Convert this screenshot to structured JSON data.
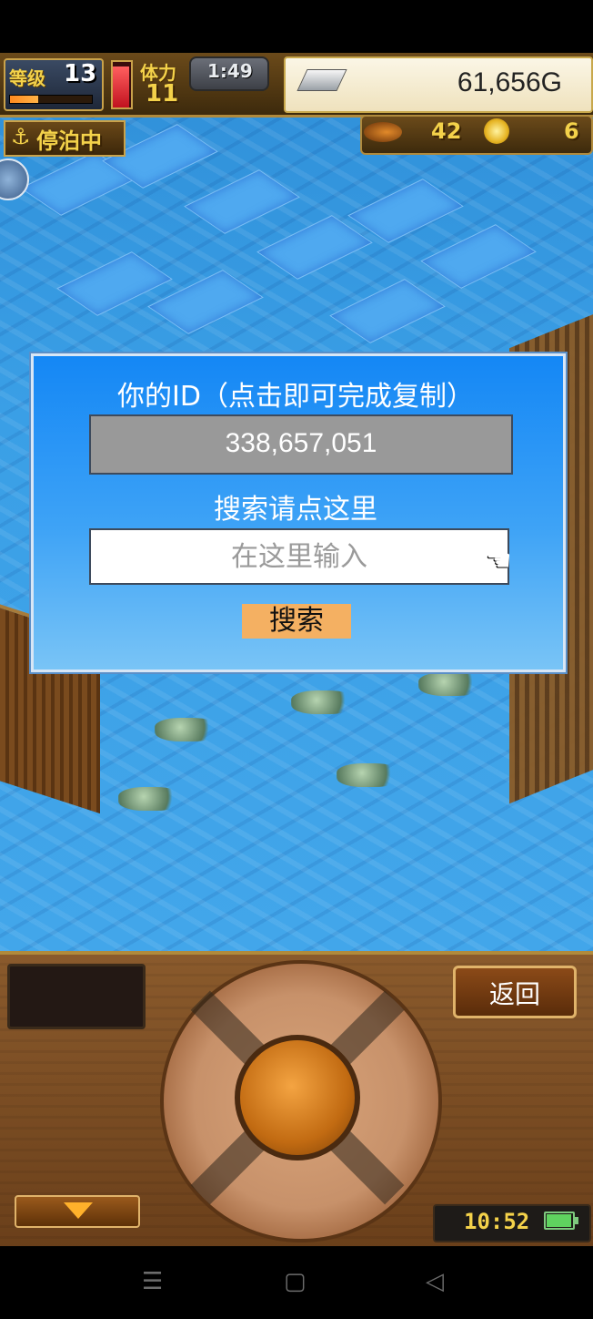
{
  "hud": {
    "level_label": "等级",
    "level_value": "13",
    "level_progress": 0.35,
    "stamina_label": "体力",
    "stamina_value": "11",
    "stamina_fill": 0.9,
    "timer": "1:49",
    "gold": "61,656G",
    "moored_label": "停泊中",
    "fish_count": "42",
    "coin_count": "6"
  },
  "dialog": {
    "title": "你的ID（点击即可完成复制）",
    "id_value": "338,657,051",
    "search_hint": "搜索请点这里",
    "search_placeholder": "在这里输入",
    "search_button": "搜索"
  },
  "controls": {
    "back_button": "返回",
    "clock": "10:52",
    "battery_level": 0.95
  },
  "icons": {
    "anchor": "anchor-icon",
    "hand_pointer": "hand-pointer-icon",
    "down_arrow": "down-arrow-icon",
    "nav_menu": "menu-icon",
    "nav_home": "home-icon",
    "nav_back": "back-icon"
  },
  "colors": {
    "dialog_blue": "#1487f5",
    "search_button_orange": "#f4b062",
    "hud_gold_text": "#f4d24a"
  }
}
